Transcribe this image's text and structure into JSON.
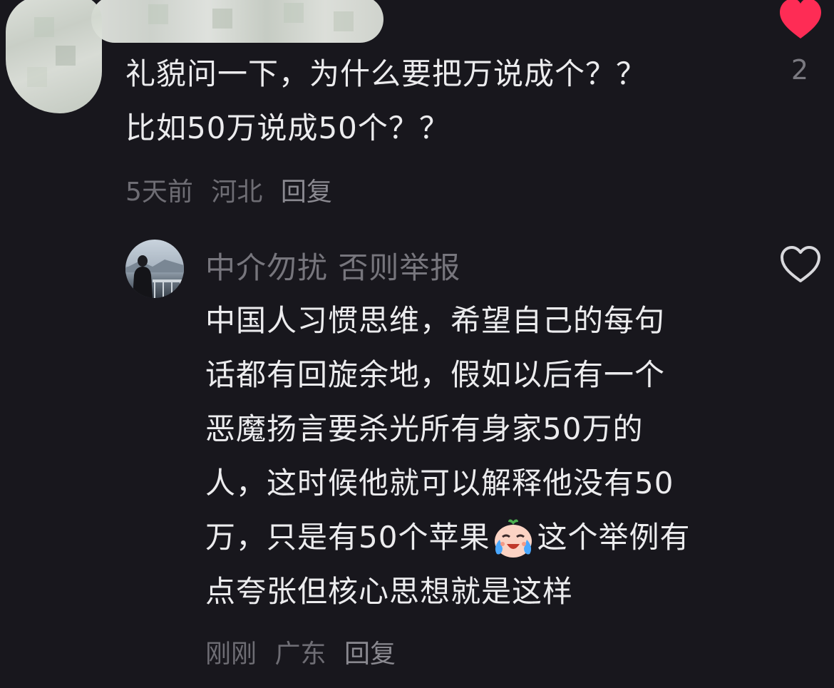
{
  "comment": {
    "text_lines": [
      "礼貌问一下，为什么要把万说成个？？",
      "比如50万说成50个？？"
    ],
    "time": "5天前",
    "location": "河北",
    "reply_label": "回复",
    "like_count": "2",
    "liked": true,
    "like_color": "#fe2c55"
  },
  "reply": {
    "username": "中介勿扰 否则举报",
    "text_lines": [
      "中国人习惯思维，希望自己的每句",
      "话都有回旋余地，假如以后有一个",
      "恶魔扬言要杀光所有身家50万的",
      "人，这时候他就可以解释他没有50",
      "万，只是有50个苹果",
      "这个举例有",
      "点夸张但核心思想就是这样"
    ],
    "emoji": "crying-laughing-emoji",
    "time": "刚刚",
    "location": "广东",
    "reply_label": "回复",
    "liked": false
  }
}
